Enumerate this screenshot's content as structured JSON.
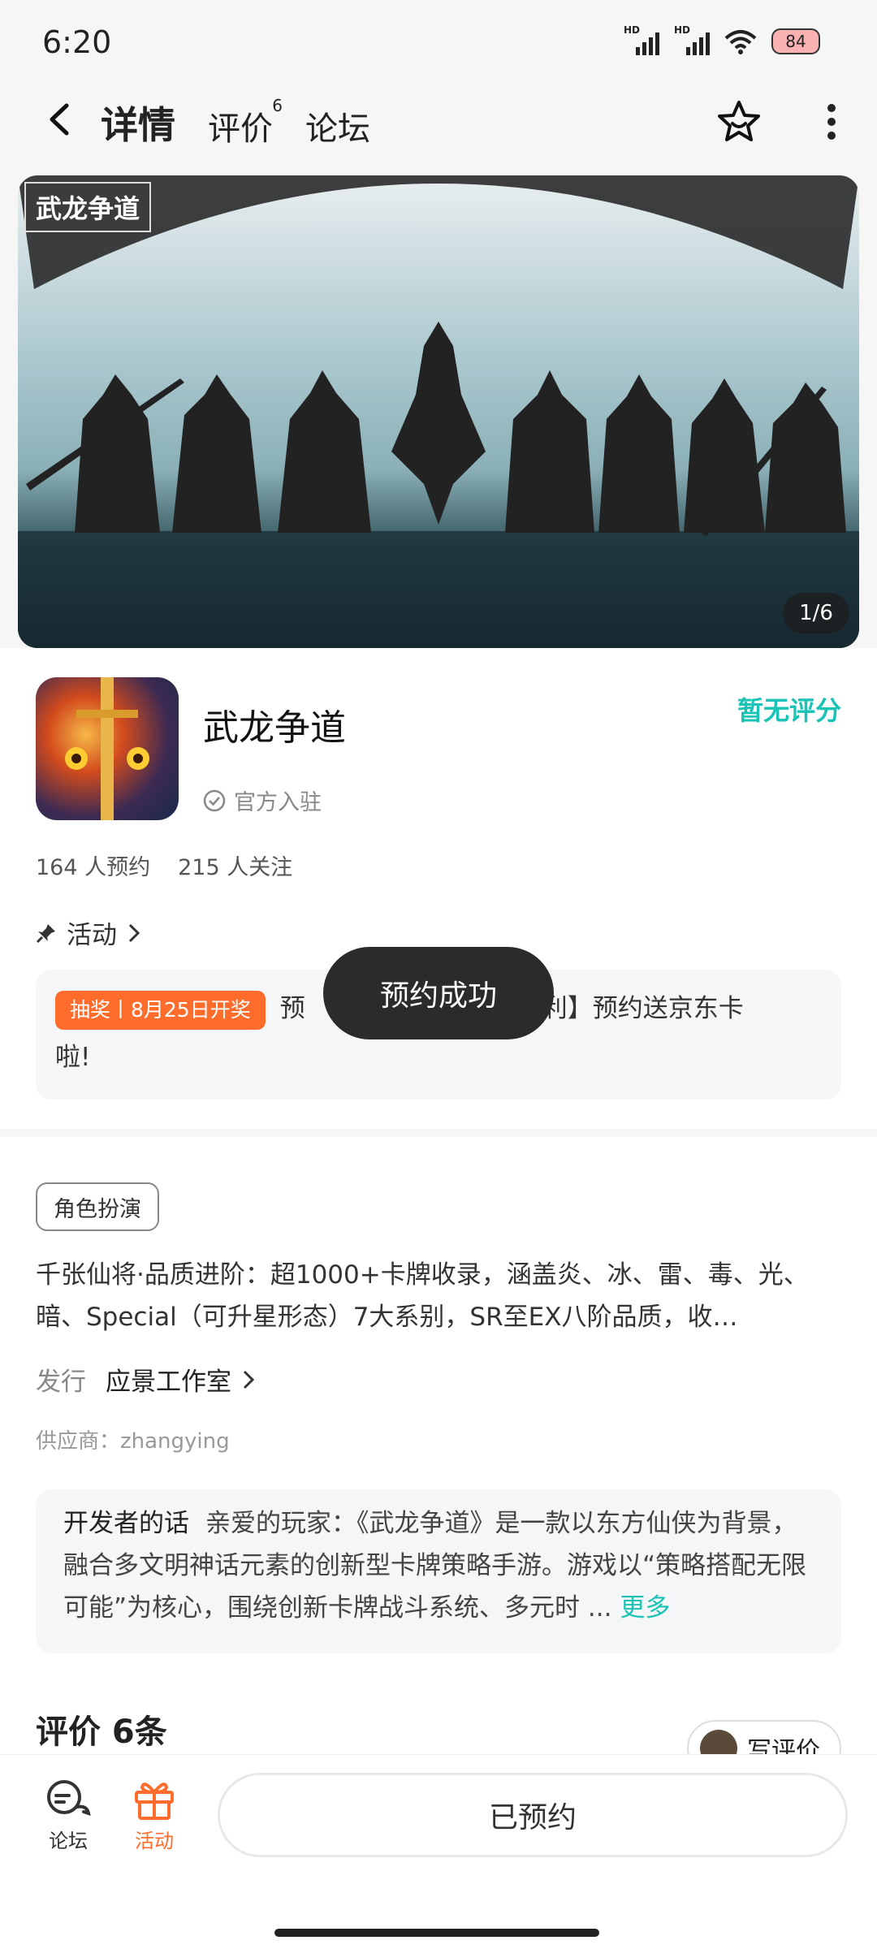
{
  "status": {
    "time": "6:20",
    "battery": "84",
    "signal1": "HD",
    "signal2": "HD"
  },
  "nav": {
    "tabs": [
      {
        "label": "详情"
      },
      {
        "label": "评价",
        "sup": "6"
      },
      {
        "label": "论坛"
      }
    ]
  },
  "banner": {
    "logo_text": "武龙争道",
    "counter": "1/6"
  },
  "app": {
    "name": "武龙争道",
    "official": "官方入驻",
    "rating_status": "暂无评分",
    "reservations": "164 人预约",
    "follows": "215 人关注"
  },
  "activity": {
    "heading": "活动",
    "tag": "抽奖丨8月25日开奖",
    "text_start": "预",
    "text_end": "力福利】预约送京东卡",
    "text_line2": "啦!"
  },
  "toast": "预约成功",
  "details": {
    "genre": "角色扮演",
    "description": "千张仙将·品质进阶：超1000+卡牌收录，涵盖炎、冰、雷、毒、光、暗、Special（可升星形态）7大系别，SR至EX八阶品质，收…",
    "publisher_key": "发行",
    "publisher_value": "应景工作室",
    "supplier": "供应商：zhangying",
    "dev_key": "开发者的话",
    "dev_text": "亲爱的玩家：《武龙争道》是一款以东方仙侠为背景，融合多文明神话元素的创新型卡牌策略手游。游戏以“策略搭配无限可能”为核心，围绕创新卡牌战斗系统、多元时 ...",
    "dev_more": "更多"
  },
  "reviews": {
    "heading": "评价 6条",
    "write": "写评价"
  },
  "bottom": {
    "forum": "论坛",
    "activity": "活动",
    "reserved": "已预约"
  },
  "colors": {
    "accent": "#1ccfc0",
    "orange": "#ff6c2c"
  }
}
